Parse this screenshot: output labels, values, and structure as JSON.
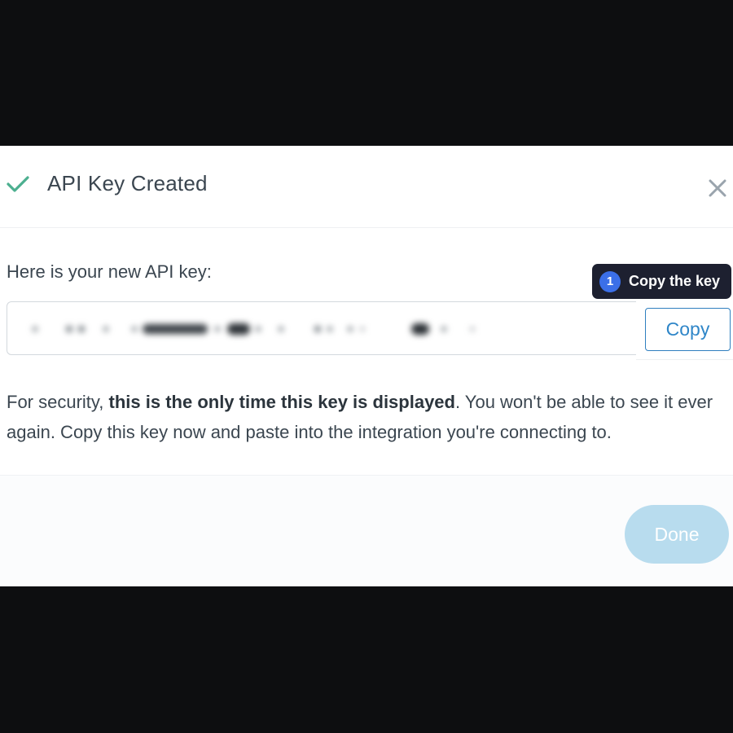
{
  "dialog": {
    "title": "API Key Created",
    "icon": "check-icon",
    "close_icon": "close-icon",
    "key_label": "Here is your new API key:",
    "copy_label": "Copy",
    "notice": {
      "prefix": "For security, ",
      "bold": "this is the only time this key is displayed",
      "suffix": ". You won't be able to see it ever again. Copy this key now and paste into the integration you're connecting to."
    },
    "done_label": "Done"
  },
  "tooltip": {
    "step": "1",
    "text": "Copy the key"
  },
  "colors": {
    "check": "#4caf8f",
    "accent": "#2f86c8",
    "done_bg": "#b8dcee",
    "tooltip_bg": "#1d2030",
    "badge": "#3b6fe8"
  }
}
